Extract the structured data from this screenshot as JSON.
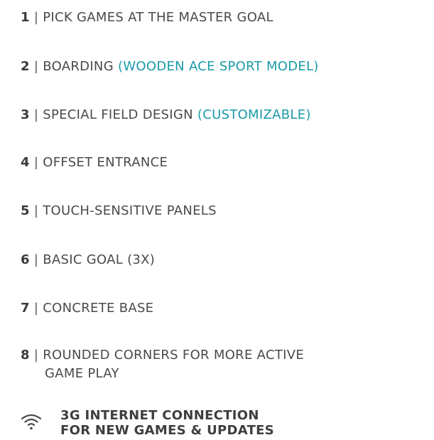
{
  "features": [
    {
      "num": "1",
      "sep": " | ",
      "text": "PICK GAMES AT THE MASTER GOAL",
      "accent": ""
    },
    {
      "num": "2",
      "sep": " | ",
      "text": "BOARDING ",
      "accent": "(WOODEN ACE SPORT MODEL)"
    },
    {
      "num": "3",
      "sep": " | ",
      "text": "SPECIAL FIELD DESIGN ",
      "accent": "(CUSTOMIZABLE)"
    },
    {
      "num": "4",
      "sep": " | ",
      "text": "OFFSET ENTRANCE",
      "accent": ""
    },
    {
      "num": "5",
      "sep": " | ",
      "text": "TOUCH-SENSITIVE PANELS",
      "accent": ""
    },
    {
      "num": "6",
      "sep": " | ",
      "text": "BASIC GOAL (3X)",
      "accent": ""
    },
    {
      "num": "7",
      "sep": " | ",
      "text": "CONCRETE BASE",
      "accent": ""
    },
    {
      "num": "8",
      "sep": " | ",
      "text": "ROUNDED CORNERS FOR MORE ACTIVE",
      "text2": "GAME PLAY",
      "accent": ""
    }
  ],
  "connection": {
    "icon": "wifi-icon",
    "line1": "3G INTERNET CONNECTION",
    "line2": "FOR NEW GAMES & UPDATES"
  },
  "colors": {
    "text": "#4a4a4a",
    "accent": "#1a9aa8"
  }
}
